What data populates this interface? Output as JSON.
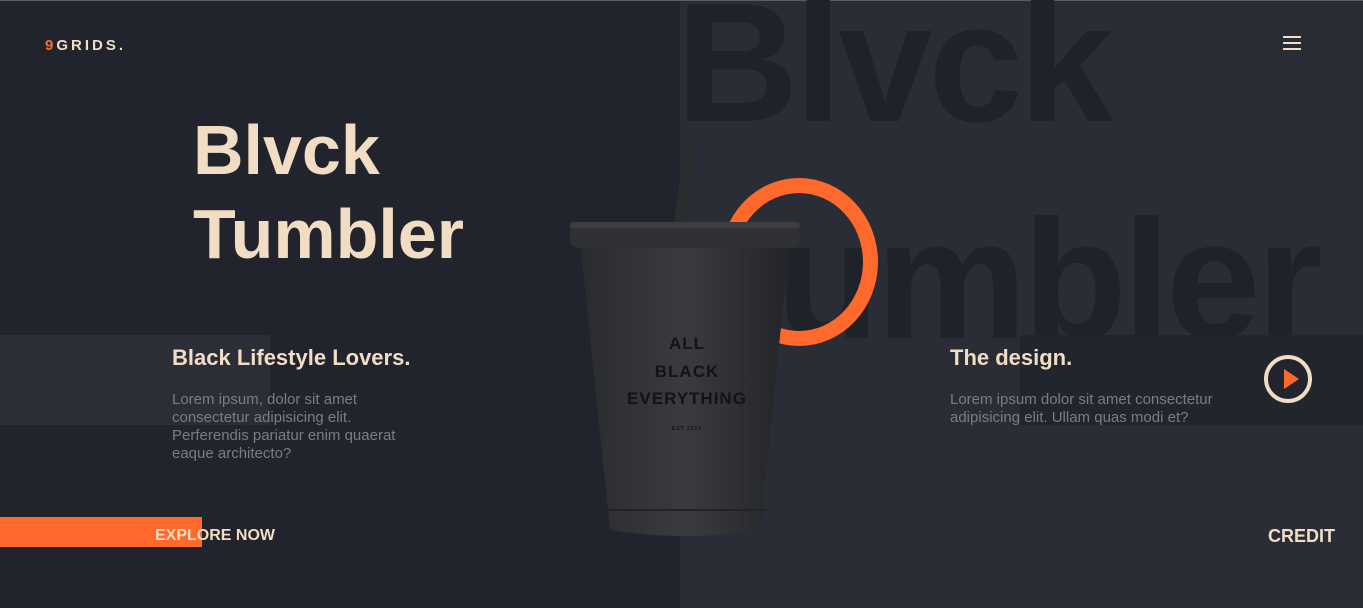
{
  "brand": {
    "number": "9",
    "name": "GRIDS."
  },
  "background_text": {
    "line1": "Blvck",
    "line2": "umbler"
  },
  "hero": {
    "title_line1": "Blvck",
    "title_line2": "Tumbler"
  },
  "left_section": {
    "heading": "Black Lifestyle Lovers.",
    "text": "Lorem ipsum, dolor sit amet consectetur adipisicing elit. Perferendis pariatur enim quaerat eaque architecto?"
  },
  "right_section": {
    "heading": "The design.",
    "text": "Lorem ipsum dolor sit amet consectetur adipisicing elit. Ullam quas modi et?"
  },
  "product": {
    "print_line1": "ALL",
    "print_line2": "BLACK",
    "print_line3": "EVERYTHING",
    "print_small": "EST 2020"
  },
  "actions": {
    "explore": "EXPLORE NOW",
    "credit": "CREDIT"
  },
  "icons": {
    "menu": "hamburger-menu-icon",
    "play": "play-icon"
  },
  "colors": {
    "accent": "#ff6a2c",
    "cream": "#f1dcc4",
    "bg_left": "#21242c",
    "bg_right": "#2a2d36"
  }
}
